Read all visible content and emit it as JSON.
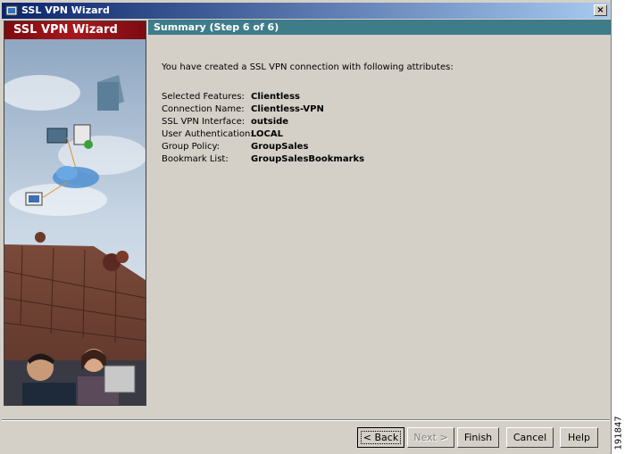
{
  "window": {
    "title": "SSL VPN Wizard",
    "close_glyph": "×"
  },
  "brand": {
    "text": "SSL VPN Wizard"
  },
  "header": {
    "title": "Summary  (Step 6 of 6)"
  },
  "summary": {
    "intro": "You have created a SSL VPN connection with following attributes:",
    "attributes": [
      {
        "label": "Selected Features:",
        "value": "Clientless"
      },
      {
        "label": "Connection Name:",
        "value": "Clientless-VPN"
      },
      {
        "label": "SSL VPN Interface:",
        "value": "outside"
      },
      {
        "label": "User Authentication:",
        "value": "LOCAL"
      },
      {
        "label": "Group Policy:",
        "value": "GroupSales"
      },
      {
        "label": "Bookmark List:",
        "value": "GroupSalesBookmarks"
      }
    ]
  },
  "buttons": {
    "back": "< Back",
    "next": "Next >",
    "finish": "Finish",
    "cancel": "Cancel",
    "help": "Help"
  },
  "figure_id": "191847",
  "icons": [
    "app-icon",
    "close-icon"
  ]
}
